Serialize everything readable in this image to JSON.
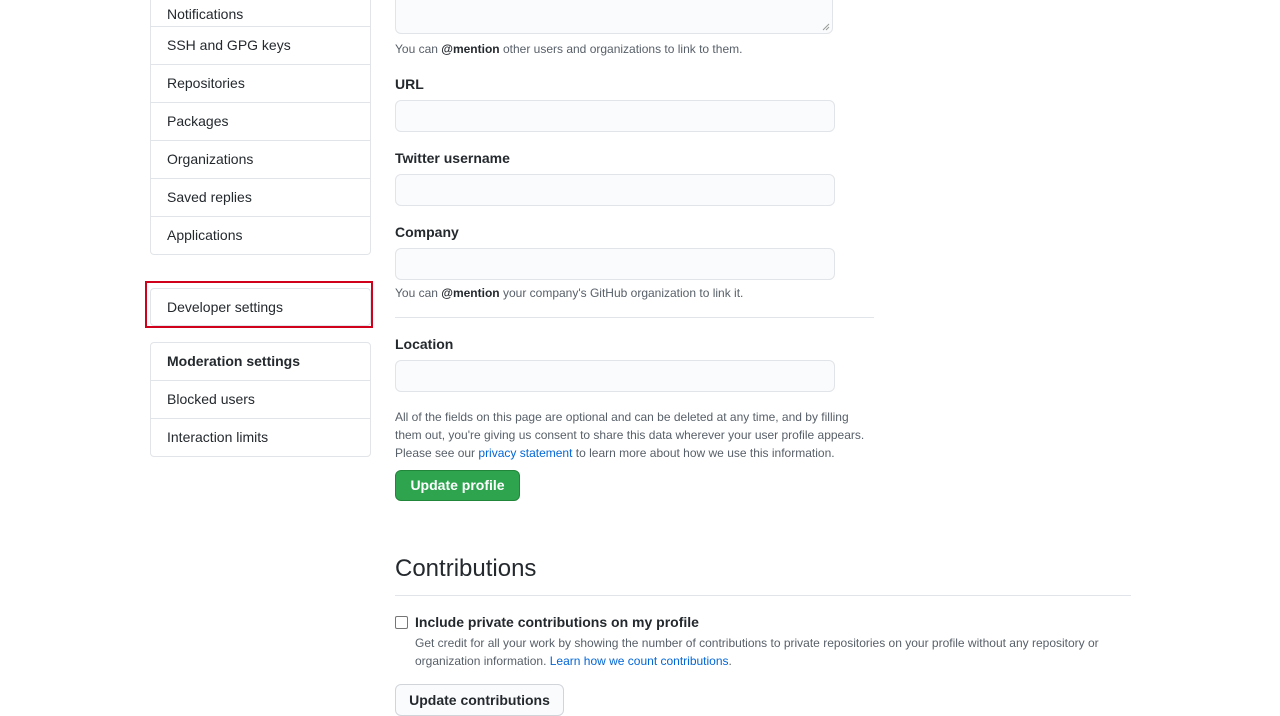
{
  "sidebar": {
    "items": [
      {
        "label": "Notifications"
      },
      {
        "label": "SSH and GPG keys"
      },
      {
        "label": "Repositories"
      },
      {
        "label": "Packages"
      },
      {
        "label": "Organizations"
      },
      {
        "label": "Saved replies"
      },
      {
        "label": "Applications"
      }
    ],
    "developer_settings": "Developer settings",
    "moderation": {
      "header": "Moderation settings",
      "items": [
        {
          "label": "Blocked users"
        },
        {
          "label": "Interaction limits"
        }
      ]
    }
  },
  "profile_form": {
    "bio_note": {
      "pre": "You can ",
      "mention": "@mention",
      "post": " other users and organizations to link to them."
    },
    "url_label": "URL",
    "twitter_label": "Twitter username",
    "company_label": "Company",
    "company_note": {
      "pre": "You can ",
      "mention": "@mention",
      "post": " your company's GitHub organization to link it."
    },
    "location_label": "Location",
    "disclaimer": {
      "text": "All of the fields on this page are optional and can be deleted at any time, and by filling them out, you're giving us consent to share this data wherever your user profile appears. Please see our ",
      "link": "privacy statement",
      "post": " to learn more about how we use this information."
    },
    "update_button": "Update profile"
  },
  "contributions": {
    "title": "Contributions",
    "checkbox_label": "Include private contributions on my profile",
    "checkbox_checked": false,
    "description": "Get credit for all your work by showing the number of contributions to private repositories on your profile without any repository or organization information. ",
    "description_link": "Learn how we count contributions",
    "description_post": ".",
    "update_button": "Update contributions"
  },
  "colors": {
    "primary_button": "#2ea44f",
    "link": "#0366d6",
    "highlight_border": "#d0021b"
  }
}
